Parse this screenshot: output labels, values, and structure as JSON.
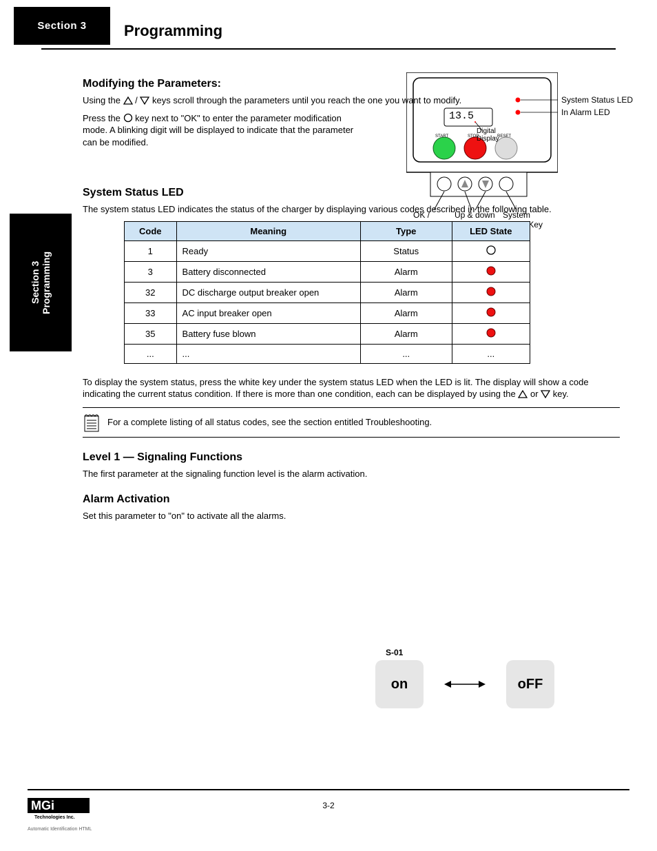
{
  "header": {
    "section": "Section 3",
    "title": "Programming"
  },
  "sideTab": "Section 3\nProgramming",
  "h_modify": "Modifying the Parameters:",
  "p_modify_1_a": "Using the",
  "p_modify_1_b": "/",
  "p_modify_1_c": "keys scroll through the parameters until you reach the one you want to modify.",
  "p_modify_2_a": "Press the",
  "p_modify_2_b": "key next to \"OK\" to enter the parameter modification mode. A blinking digit will be displayed to indicate that the parameter can be modified.",
  "h_system": "System Status LED",
  "p_system": "The system status LED indicates the status of the charger by displaying various codes described in the following table.",
  "table": {
    "headers": [
      "Code",
      "Meaning",
      "Type",
      "LED State"
    ],
    "rows": [
      {
        "code": "1",
        "meaning": "Ready",
        "type": "Status",
        "led": "unlit"
      },
      {
        "code": "3",
        "meaning": "Battery disconnected",
        "type": "Alarm",
        "led": "red"
      },
      {
        "code": "32",
        "meaning": "DC discharge output breaker open",
        "type": "Alarm",
        "led": "red"
      },
      {
        "code": "33",
        "meaning": "AC input breaker open",
        "type": "Alarm",
        "led": "red"
      },
      {
        "code": "35",
        "meaning": "Battery fuse blown",
        "type": "Alarm",
        "led": "red"
      },
      {
        "code": "...",
        "meaning": "...",
        "type": "...",
        "led": "text",
        "led_text": "..."
      }
    ]
  },
  "p_status_a": "To display the system status, press the white key under the system status LED when the LED is lit. The display will show a code indicating the current status condition. If there is more than one condition, each can be displayed by using the",
  "p_status_b": "or",
  "p_status_c": "key.",
  "note": "For a complete listing of all status codes, see the section entitled Troubleshooting.",
  "h_level": "Level 1 — Signaling Functions",
  "p_level": "The first parameter at the signaling function level is the alarm activation.",
  "h_alarm": "Alarm Activation",
  "p_alarm": "Set this parameter to \"on\" to activate all the alarms.",
  "toggle": {
    "code": "S-01",
    "on": "on",
    "off": "oFF"
  },
  "device": {
    "displayValue": "13.5",
    "btnLabels": {
      "start": "START",
      "stop": "STOP",
      "reset": "RESET"
    },
    "labels": {
      "okCancel": "OK /\nCancel",
      "keys": "Up & down\nkeys",
      "statusKey": "System\nStatus Key",
      "statusLED": "System Status LED",
      "alarmLED": "In Alarm LED",
      "digital": "Digital\nDisplay"
    }
  },
  "footer": {
    "page": "3-2",
    "autoId": "Automatic Identification HTML"
  }
}
